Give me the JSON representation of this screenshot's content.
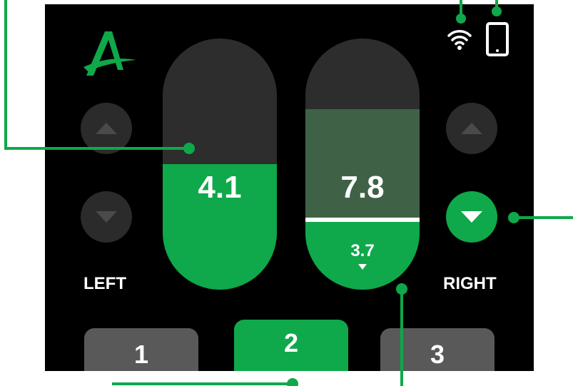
{
  "status": {
    "wifi_icon": "wifi-icon",
    "phone_icon": "phone-icon"
  },
  "logo": {
    "letter": "A",
    "icon": "brand-logo"
  },
  "left": {
    "label": "LEFT",
    "value": "4.1",
    "fill_percent": 50
  },
  "right": {
    "label": "RIGHT",
    "target_value": "7.8",
    "current_value": "3.7",
    "target_fill_percent": 72,
    "current_fill_percent": 27
  },
  "presets": [
    {
      "label": "1",
      "active": false
    },
    {
      "label": "2",
      "active": true
    },
    {
      "label": "3",
      "active": false
    }
  ],
  "colors": {
    "accent": "#0fa84a",
    "background": "#000000",
    "pill_bg": "#2d2d2d",
    "target_fill": "#3f6246",
    "button_bg": "#2b2b2b",
    "preset_bg": "#595959"
  }
}
